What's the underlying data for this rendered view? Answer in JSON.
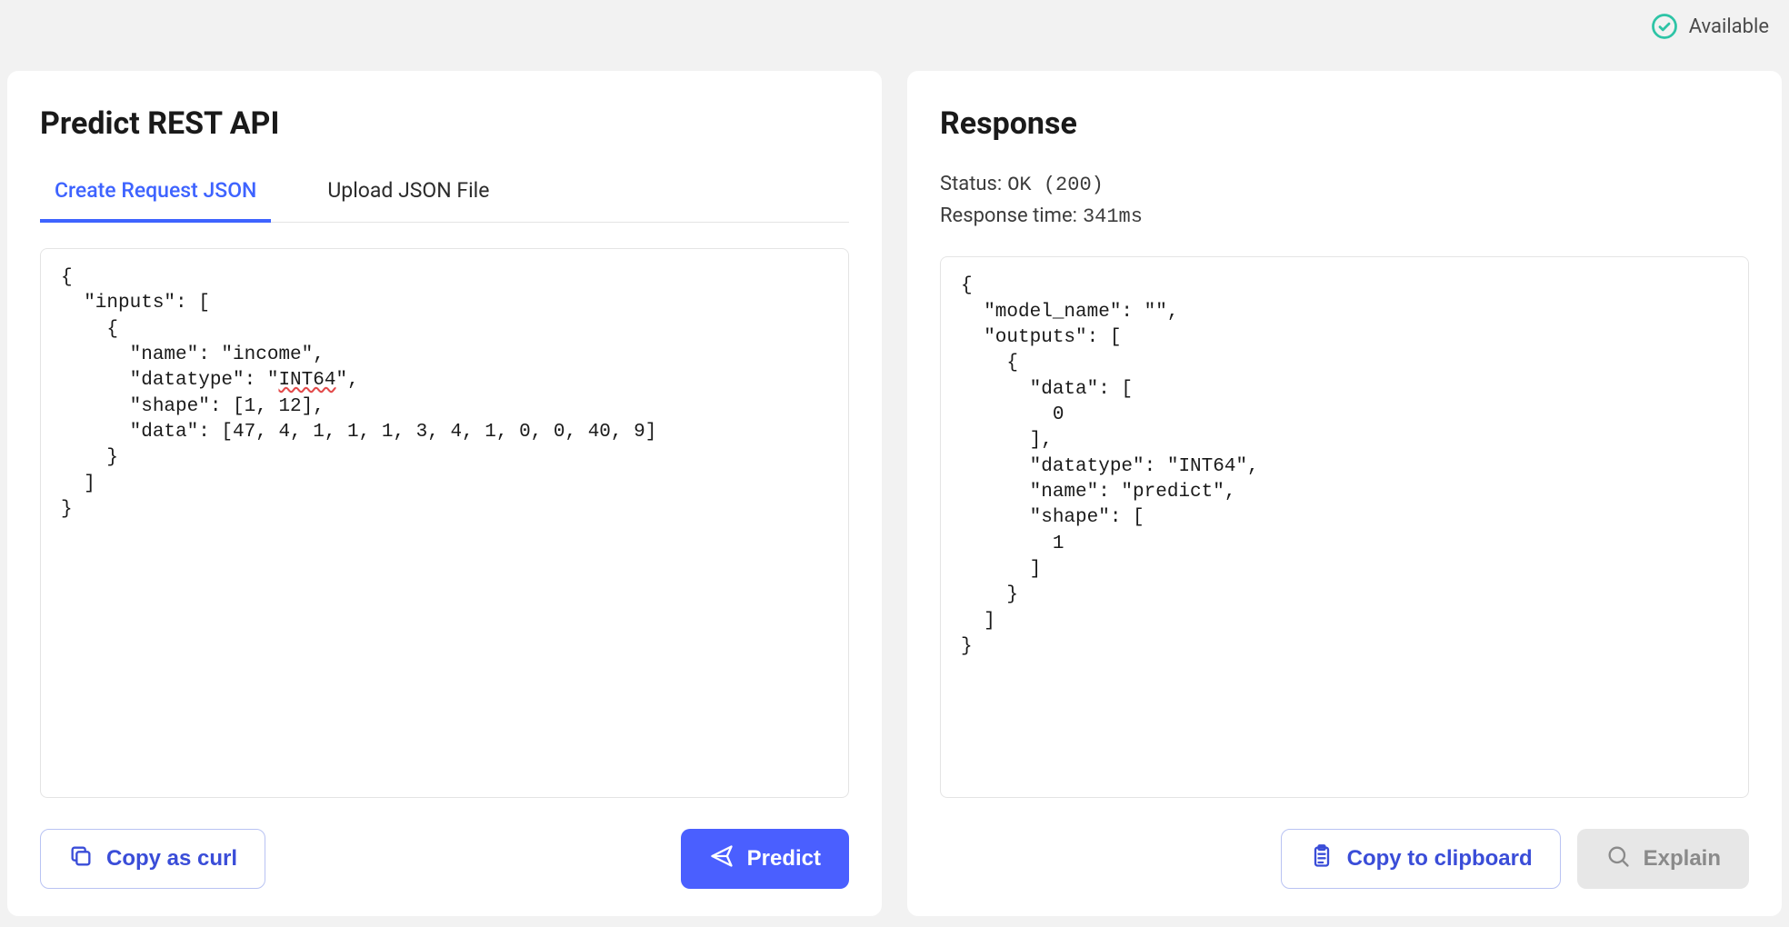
{
  "status_bar": {
    "availability_label": "Available"
  },
  "request_panel": {
    "title": "Predict REST API",
    "tabs": {
      "create": "Create Request JSON",
      "upload": "Upload JSON File"
    },
    "code_pre": "{\n  \"inputs\": [\n    {\n      \"name\": \"income\",\n      \"datatype\": \"",
    "code_int64": "INT64",
    "code_post": "\",\n      \"shape\": [1, 12],\n      \"data\": [47, 4, 1, 1, 1, 3, 4, 1, 0, 0, 40, 9]\n    }\n  ]\n}",
    "buttons": {
      "copy_curl": "Copy as curl",
      "predict": "Predict"
    }
  },
  "response_panel": {
    "title": "Response",
    "status_label": "Status:",
    "status_value": "OK (200)",
    "time_label": "Response time:",
    "time_value": "341ms",
    "code": "{\n  \"model_name\": \"\",\n  \"outputs\": [\n    {\n      \"data\": [\n        0\n      ],\n      \"datatype\": \"INT64\",\n      \"name\": \"predict\",\n      \"shape\": [\n        1\n      ]\n    }\n  ]\n}",
    "buttons": {
      "copy_clipboard": "Copy to clipboard",
      "explain": "Explain"
    }
  },
  "colors": {
    "accent": "#4a5fff",
    "accent_text": "#3a4dd8",
    "success": "#2ec4a6"
  }
}
